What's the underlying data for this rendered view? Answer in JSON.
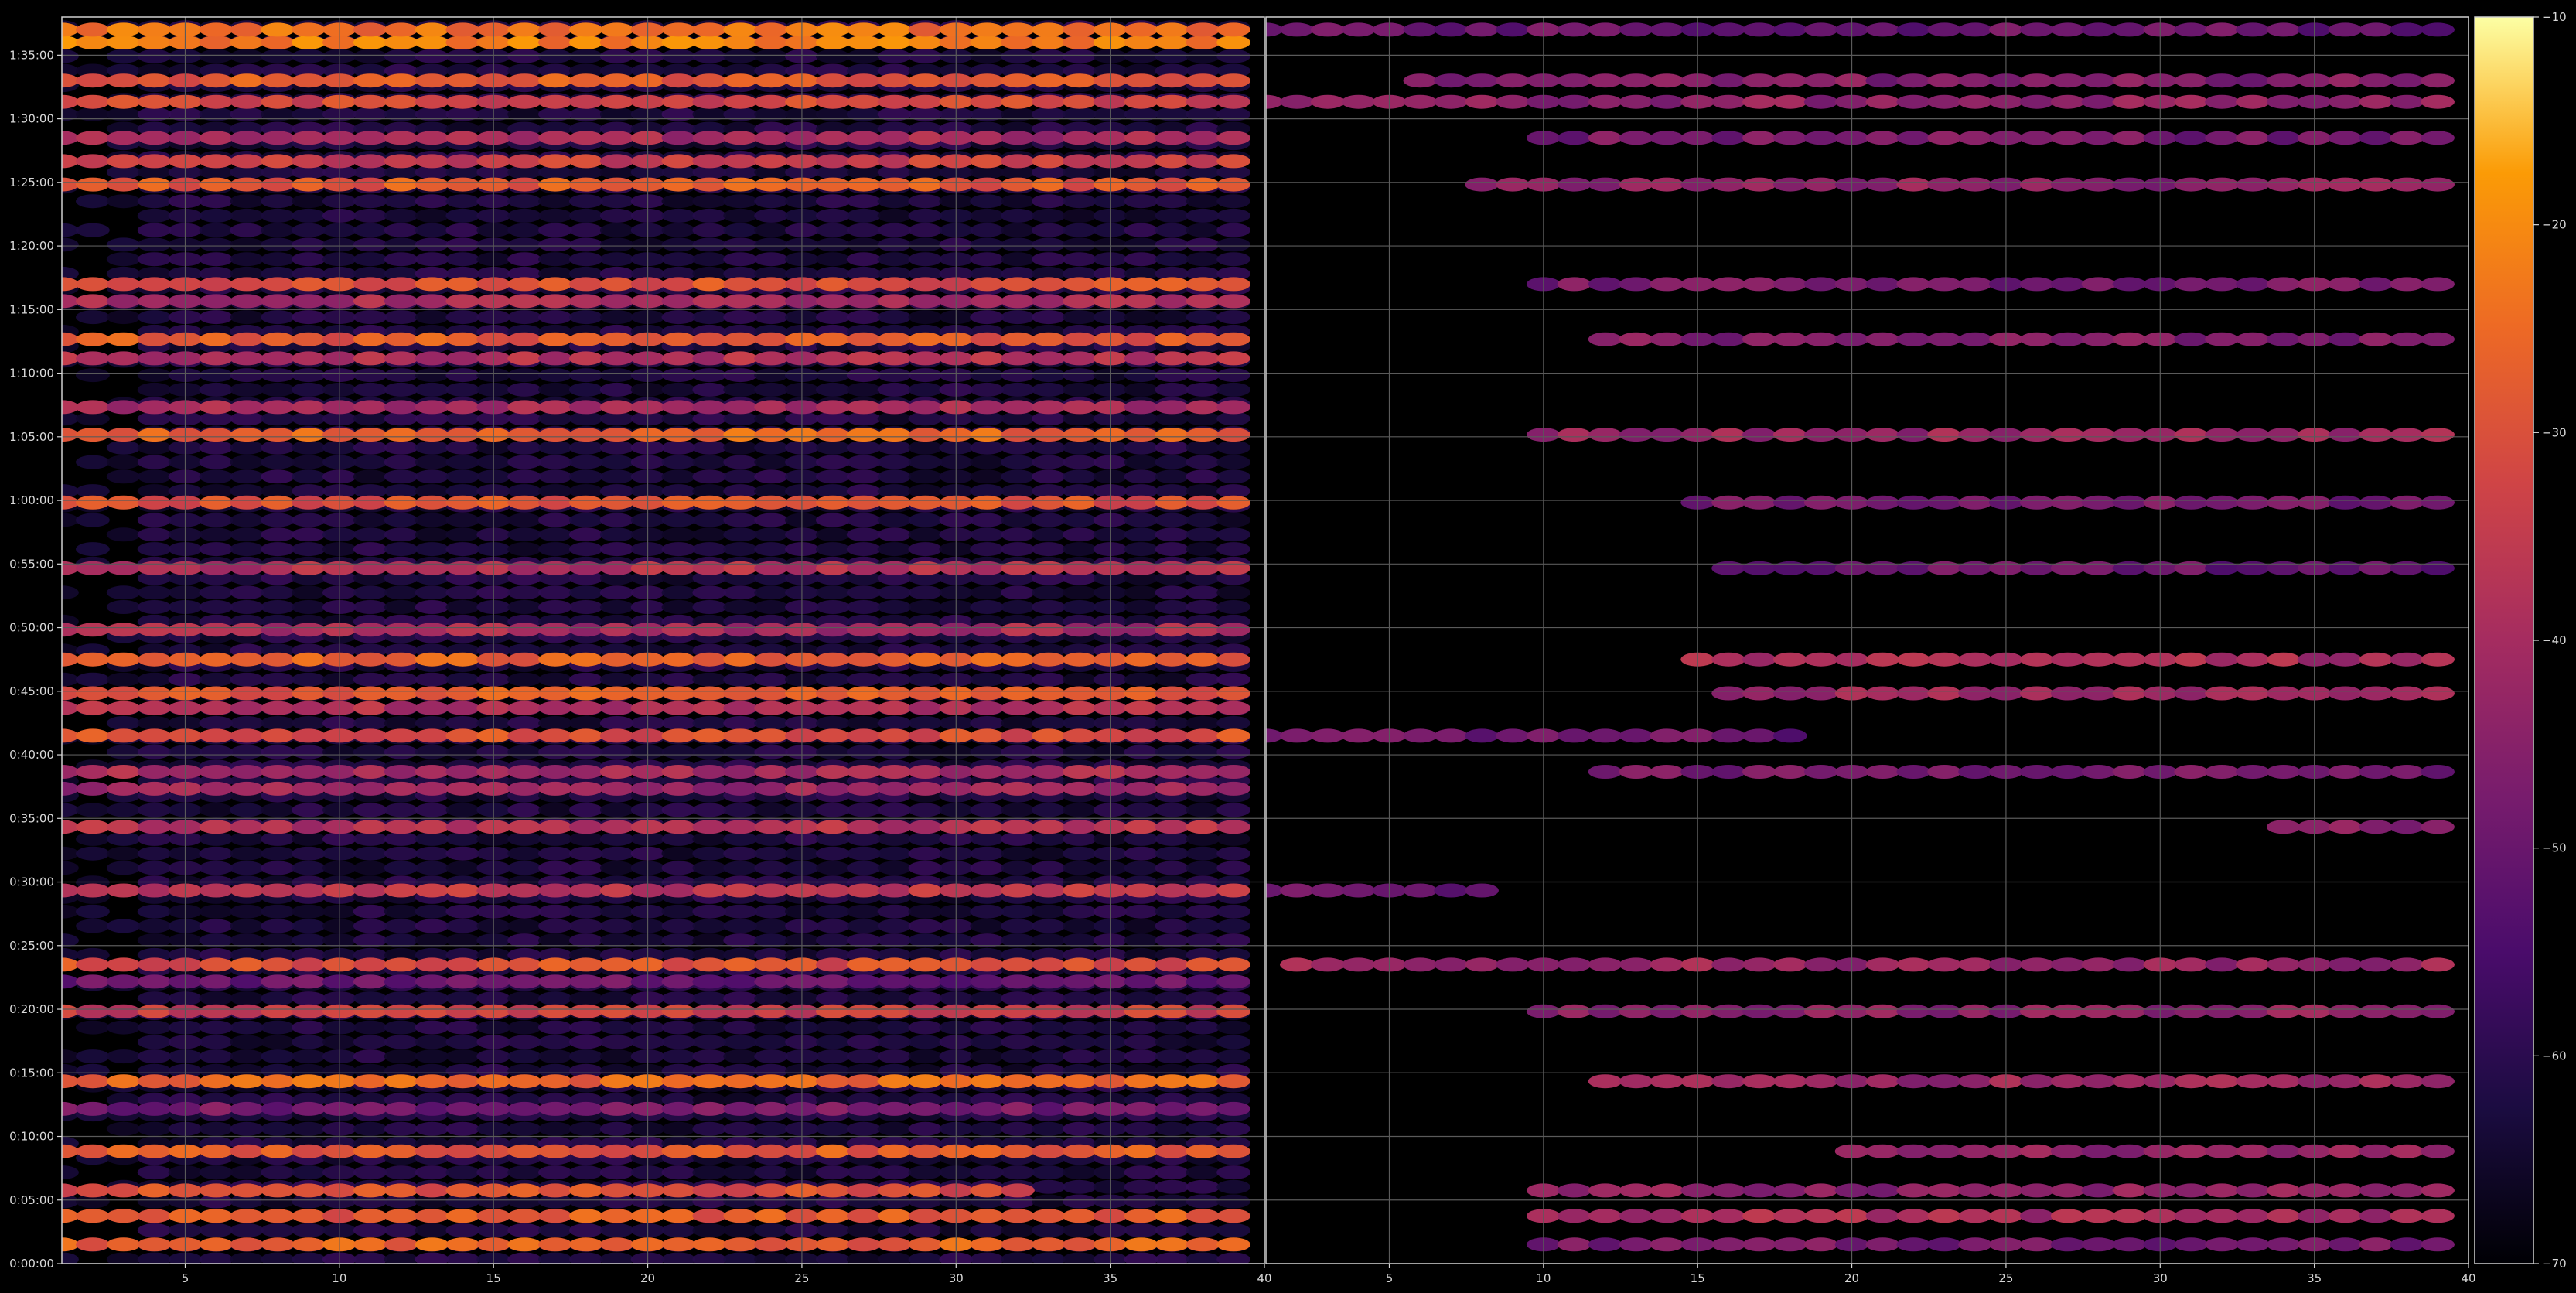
{
  "chart_data": {
    "type": "heatmap",
    "title": "",
    "xlabel": "",
    "ylabel": "",
    "grid": true,
    "colormap": "inferno",
    "background": "#000000",
    "grid_color": "#5a5a5a",
    "colorbar": {
      "vmin": -70,
      "vmax": -10,
      "ticks": [
        -70,
        -60,
        -50,
        -40,
        -30,
        -20,
        -10
      ],
      "tick_labels": [
        "−70",
        "−60",
        "−50",
        "−40",
        "−30",
        "−20",
        "−10"
      ],
      "placement": "right"
    },
    "panels": [
      {
        "name": "",
        "xlim": [
          1,
          40
        ],
        "x_ticks": [
          5,
          10,
          15,
          20,
          25,
          30,
          35,
          40
        ],
        "x_tick_labels": [
          "5",
          "10",
          "15",
          "20",
          "25",
          "30",
          "35",
          "40"
        ],
        "x_range_with_data": [
          1,
          39
        ],
        "ylim_seconds": [
          0,
          5880
        ],
        "y_ticks_seconds": [
          0,
          300,
          600,
          900,
          1200,
          1500,
          1800,
          2100,
          2400,
          2700,
          3000,
          3300,
          3600,
          3900,
          4200,
          4500,
          4800,
          5100,
          5400,
          5700
        ],
        "y_tick_labels": [
          "0:00:00",
          "0:05:00",
          "0:10:00",
          "0:15:00",
          "0:20:00",
          "0:25:00",
          "0:30:00",
          "0:35:00",
          "0:40:00",
          "0:45:00",
          "0:50:00",
          "0:55:00",
          "1:00:00",
          "1:05:00",
          "1:10:00",
          "1:15:00",
          "1:20:00",
          "1:25:00",
          "1:30:00",
          "1:35:00"
        ],
        "level_offset": 0,
        "bands": [
          {
            "t": "0:01:30",
            "level": -27,
            "x_end": 39
          },
          {
            "t": "0:03:45",
            "level": -28,
            "x_end": 39
          },
          {
            "t": "0:05:45",
            "level": -30,
            "x_end": 32
          },
          {
            "t": "0:08:50",
            "level": -28,
            "x_end": 39
          },
          {
            "t": "0:12:10",
            "level": -48,
            "x_end": 39
          },
          {
            "t": "0:14:20",
            "level": -26,
            "x_end": 39
          },
          {
            "t": "0:19:50",
            "level": -34,
            "x_end": 39
          },
          {
            "t": "0:22:10",
            "level": -50,
            "x_end": 39
          },
          {
            "t": "0:23:30",
            "level": -30,
            "x_end": 39
          },
          {
            "t": "0:29:20",
            "level": -36,
            "x_end": 39
          },
          {
            "t": "0:34:20",
            "level": -38,
            "x_end": 39
          },
          {
            "t": "0:37:20",
            "level": -42,
            "x_end": 39
          },
          {
            "t": "0:38:40",
            "level": -40,
            "x_end": 39
          },
          {
            "t": "0:41:30",
            "level": -30,
            "x_end": 39
          },
          {
            "t": "0:43:40",
            "level": -38,
            "x_end": 39
          },
          {
            "t": "0:44:50",
            "level": -28,
            "x_end": 39
          },
          {
            "t": "0:47:30",
            "level": -27,
            "x_end": 39
          },
          {
            "t": "0:49:50",
            "level": -40,
            "x_end": 39
          },
          {
            "t": "0:54:40",
            "level": -38,
            "x_end": 39
          },
          {
            "t": "0:59:50",
            "level": -30,
            "x_end": 39
          },
          {
            "t": "1:05:10",
            "level": -26,
            "x_end": 39
          },
          {
            "t": "1:07:20",
            "level": -40,
            "x_end": 39
          },
          {
            "t": "1:11:10",
            "level": -38,
            "x_end": 39
          },
          {
            "t": "1:12:40",
            "level": -28,
            "x_end": 39
          },
          {
            "t": "1:15:40",
            "level": -40,
            "x_end": 39
          },
          {
            "t": "1:17:00",
            "level": -30,
            "x_end": 39
          },
          {
            "t": "1:24:50",
            "level": -28,
            "x_end": 39
          },
          {
            "t": "1:26:40",
            "level": -34,
            "x_end": 39
          },
          {
            "t": "1:28:30",
            "level": -40,
            "x_end": 39
          },
          {
            "t": "1:31:20",
            "level": -32,
            "x_end": 39
          },
          {
            "t": "1:33:00",
            "level": -28,
            "x_end": 39
          },
          {
            "t": "1:36:00",
            "level": -22,
            "x_end": 39
          },
          {
            "t": "1:37:00",
            "level": -24,
            "x_end": 39
          }
        ]
      },
      {
        "name": "",
        "xlim": [
          1,
          40
        ],
        "x_ticks": [
          5,
          10,
          15,
          20,
          25,
          30,
          35,
          40
        ],
        "x_tick_labels": [
          "5",
          "10",
          "15",
          "20",
          "25",
          "30",
          "35",
          "40"
        ],
        "x_range_with_data": [
          1,
          39
        ],
        "ylim_seconds": [
          0,
          5880
        ],
        "y_ticks_seconds": [
          0,
          300,
          600,
          900,
          1200,
          1500,
          1800,
          2100,
          2400,
          2700,
          3000,
          3300,
          3600,
          3900,
          4200,
          4500,
          4800,
          5100,
          5400,
          5700
        ],
        "level_offset": -14,
        "bands": [
          {
            "t": "0:01:30",
            "level": -48,
            "x_start": 10,
            "x_end": 39
          },
          {
            "t": "0:03:45",
            "level": -40,
            "x_start": 10,
            "x_end": 39
          },
          {
            "t": "0:05:45",
            "level": -44,
            "x_start": 10,
            "x_end": 39
          },
          {
            "t": "0:08:50",
            "level": -44,
            "x_start": 20,
            "x_end": 39
          },
          {
            "t": "0:14:20",
            "level": -42,
            "x_start": 12,
            "x_end": 39
          },
          {
            "t": "0:19:50",
            "level": -44,
            "x_start": 10,
            "x_end": 39
          },
          {
            "t": "0:23:30",
            "level": -42,
            "x_start": 2,
            "x_end": 39
          },
          {
            "t": "0:29:20",
            "level": -50,
            "x_start": 1,
            "x_end": 8
          },
          {
            "t": "0:34:20",
            "level": -44,
            "x_start": 34,
            "x_end": 39
          },
          {
            "t": "0:38:40",
            "level": -48,
            "x_start": 12,
            "x_end": 39
          },
          {
            "t": "0:41:30",
            "level": -50,
            "x_start": 1,
            "x_end": 18
          },
          {
            "t": "0:44:50",
            "level": -42,
            "x_start": 16,
            "x_end": 39
          },
          {
            "t": "0:47:30",
            "level": -40,
            "x_start": 15,
            "x_end": 39
          },
          {
            "t": "0:54:40",
            "level": -50,
            "x_start": 16,
            "x_end": 39
          },
          {
            "t": "0:59:50",
            "level": -48,
            "x_start": 15,
            "x_end": 39
          },
          {
            "t": "1:05:10",
            "level": -42,
            "x_start": 10,
            "x_end": 39
          },
          {
            "t": "1:12:40",
            "level": -46,
            "x_start": 12,
            "x_end": 39
          },
          {
            "t": "1:17:00",
            "level": -48,
            "x_start": 10,
            "x_end": 39
          },
          {
            "t": "1:24:50",
            "level": -44,
            "x_start": 8,
            "x_end": 39
          },
          {
            "t": "1:28:30",
            "level": -48,
            "x_start": 10,
            "x_end": 39
          },
          {
            "t": "1:31:20",
            "level": -44,
            "x_start": 1,
            "x_end": 39
          },
          {
            "t": "1:33:00",
            "level": -46,
            "x_start": 6,
            "x_end": 39
          },
          {
            "t": "1:37:00",
            "level": -50,
            "x_start": 1,
            "x_end": 39
          }
        ]
      }
    ]
  }
}
